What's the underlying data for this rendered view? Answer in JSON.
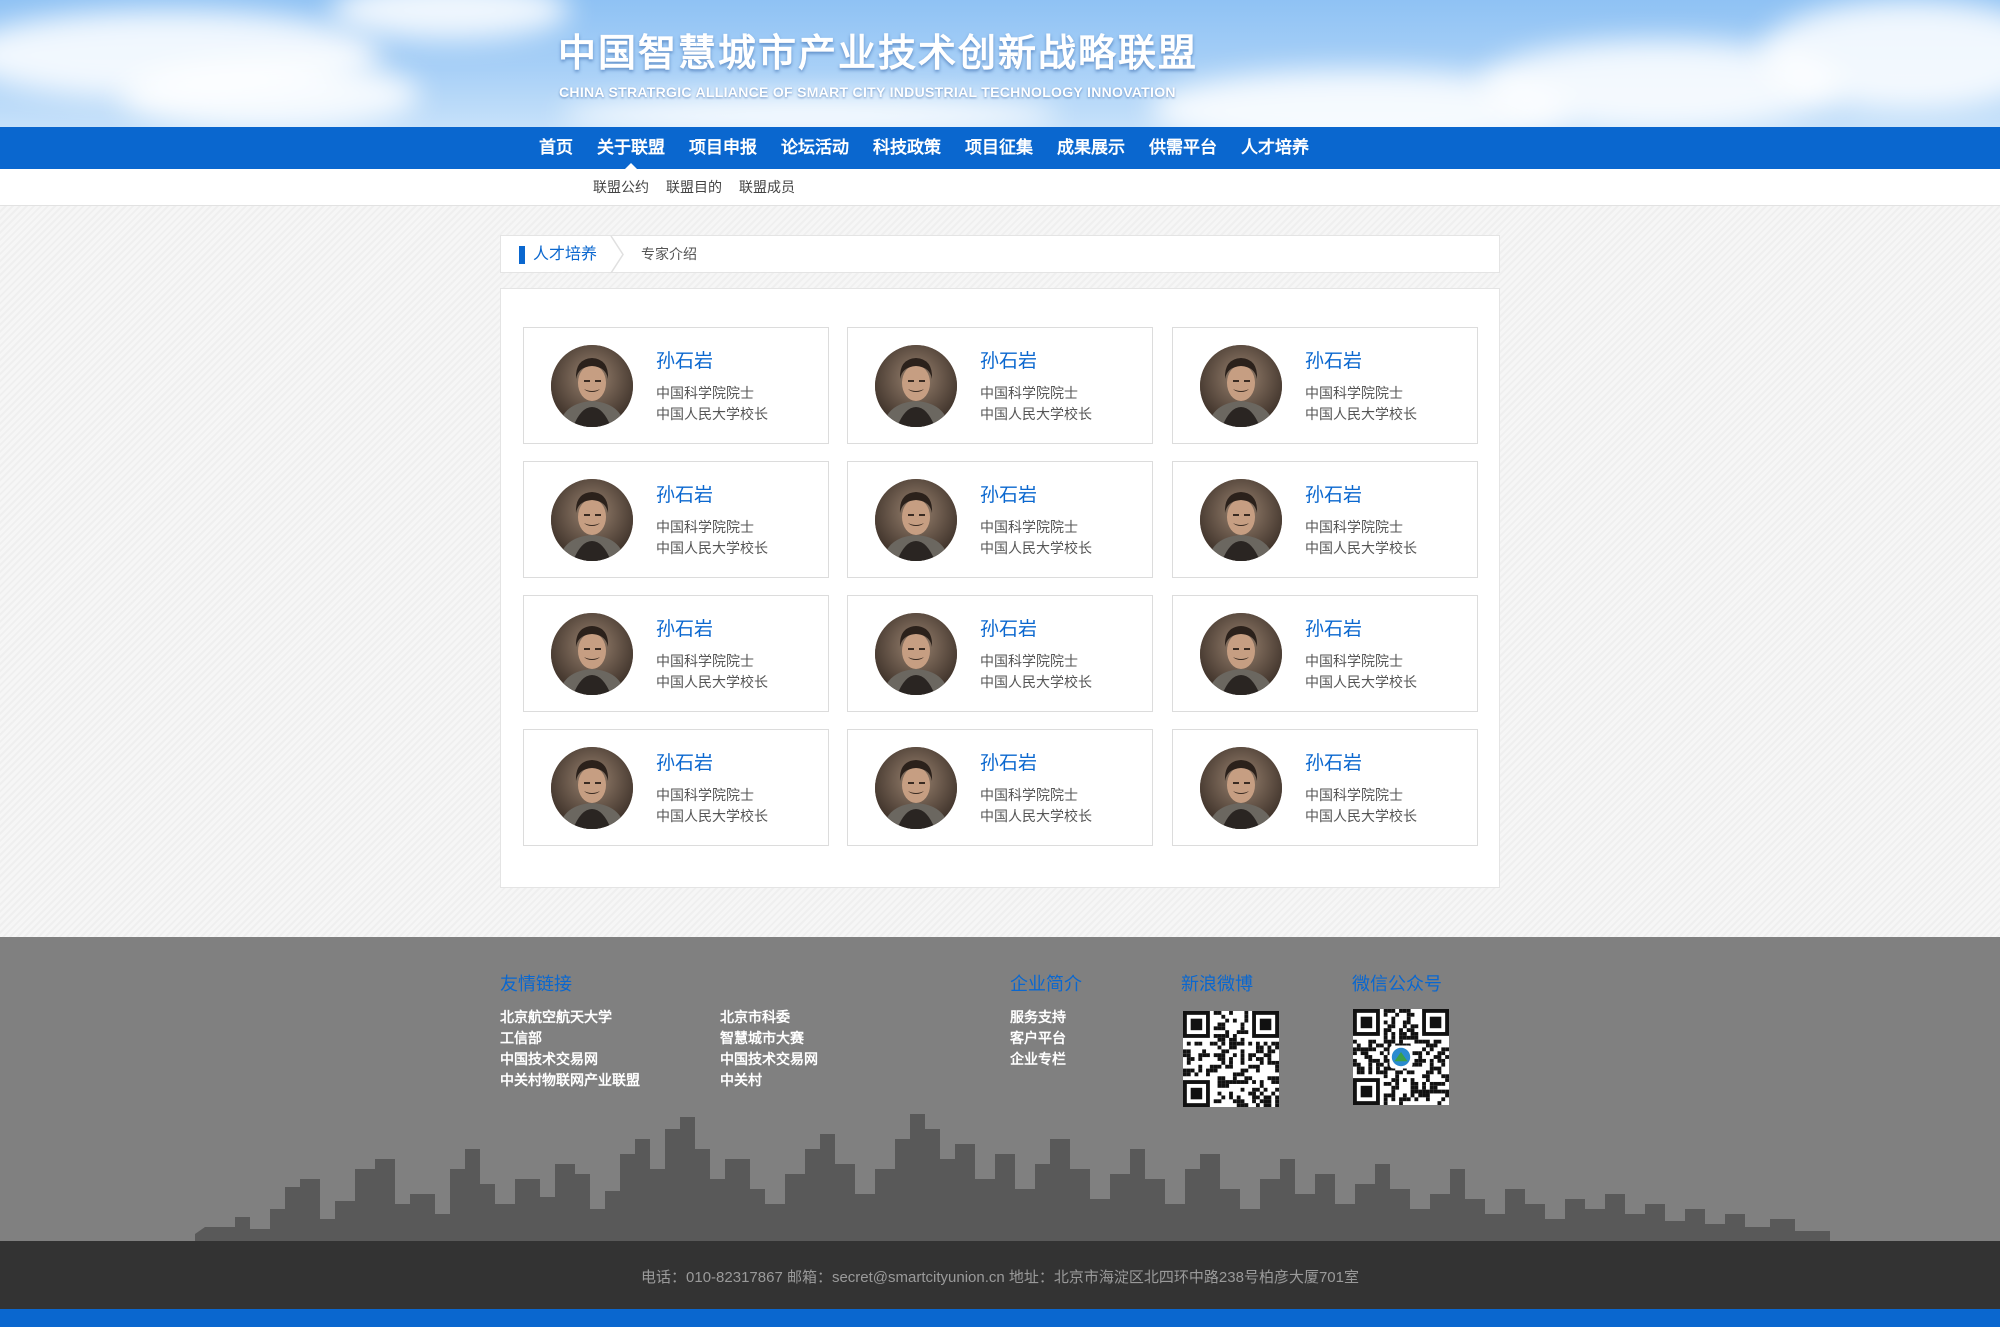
{
  "header": {
    "title": "中国智慧城市产业技术创新战略联盟",
    "subtitle": "CHINA STRATRGIC ALLIANCE OF SMART CITY INDUSTRIAL TECHNOLOGY INNOVATION"
  },
  "nav": {
    "items": [
      "首页",
      "关于联盟",
      "项目申报",
      "论坛活动",
      "科技政策",
      "项目征集",
      "成果展示",
      "供需平台",
      "人才培养"
    ],
    "active": "关于联盟"
  },
  "subnav": {
    "items": [
      "联盟公约",
      "联盟目的",
      "联盟成员"
    ]
  },
  "breadcrumb": {
    "section": "人才培养",
    "page": "专家介绍"
  },
  "experts": [
    {
      "name": "孙石岩",
      "line1": "中国科学院院士",
      "line2": "中国人民大学校长"
    },
    {
      "name": "孙石岩",
      "line1": "中国科学院院士",
      "line2": "中国人民大学校长"
    },
    {
      "name": "孙石岩",
      "line1": "中国科学院院士",
      "line2": "中国人民大学校长"
    },
    {
      "name": "孙石岩",
      "line1": "中国科学院院士",
      "line2": "中国人民大学校长"
    },
    {
      "name": "孙石岩",
      "line1": "中国科学院院士",
      "line2": "中国人民大学校长"
    },
    {
      "name": "孙石岩",
      "line1": "中国科学院院士",
      "line2": "中国人民大学校长"
    },
    {
      "name": "孙石岩",
      "line1": "中国科学院院士",
      "line2": "中国人民大学校长"
    },
    {
      "name": "孙石岩",
      "line1": "中国科学院院士",
      "line2": "中国人民大学校长"
    },
    {
      "name": "孙石岩",
      "line1": "中国科学院院士",
      "line2": "中国人民大学校长"
    },
    {
      "name": "孙石岩",
      "line1": "中国科学院院士",
      "line2": "中国人民大学校长"
    },
    {
      "name": "孙石岩",
      "line1": "中国科学院院士",
      "line2": "中国人民大学校长"
    },
    {
      "name": "孙石岩",
      "line1": "中国科学院院士",
      "line2": "中国人民大学校长"
    }
  ],
  "footer": {
    "links_title": "友情链接",
    "links_col1": [
      "北京航空航天大学",
      "工信部",
      "中国技术交易网",
      "中关村物联网产业联盟"
    ],
    "links_col2": [
      "北京市科委",
      "智慧城市大赛",
      "中国技术交易网",
      "中关村"
    ],
    "company_title": "企业简介",
    "company_links": [
      "服务支持",
      "客户平台",
      "企业专栏"
    ],
    "weibo_title": "新浪微博",
    "wechat_title": "微信公众号",
    "contact": "电话：010-82317867 邮箱：secret@smartcityunion.cn 地址：北京市海淀区北四环中路238号柏彦大厦701室"
  },
  "colors": {
    "brand_blue": "#0a67cf",
    "footer_gray": "#808080",
    "bottom_bar": "#333333"
  },
  "icons": [
    "chevron-right-icon",
    "qr-code-icon",
    "avatar-photo"
  ]
}
